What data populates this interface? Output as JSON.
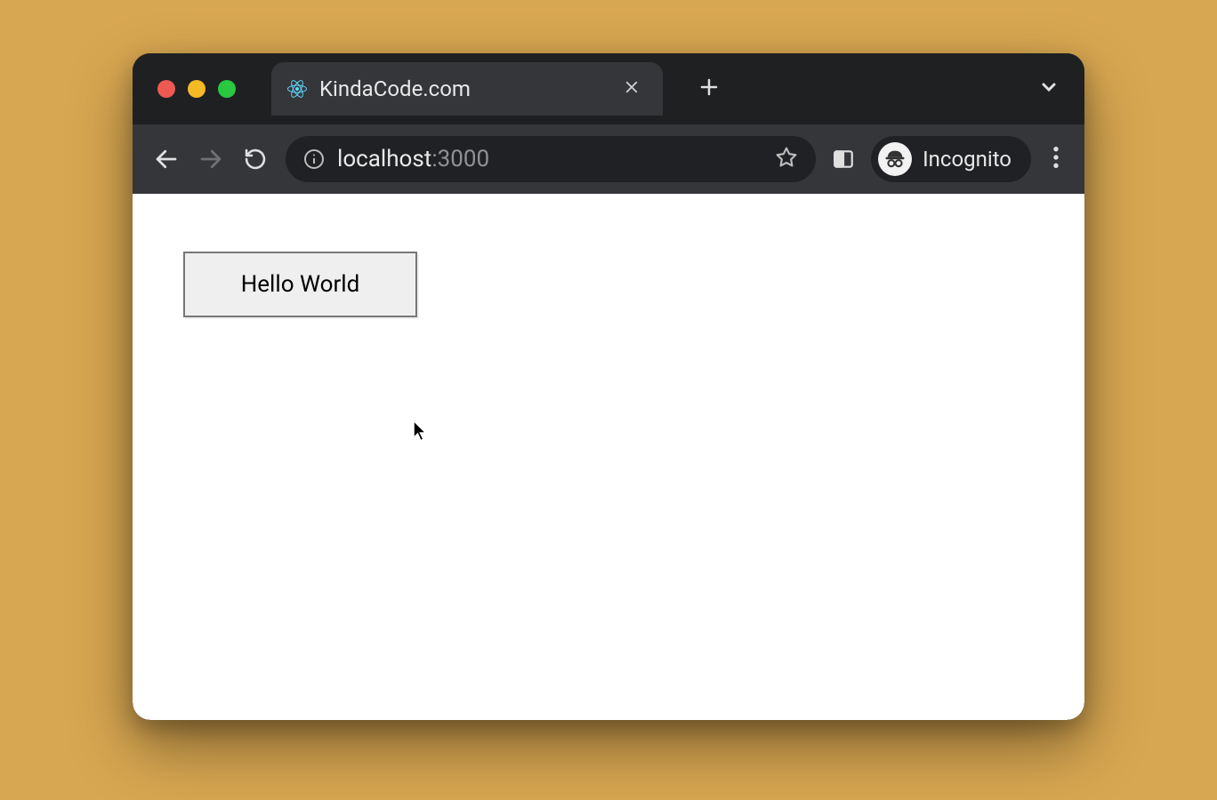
{
  "browser": {
    "tab": {
      "title": "KindaCode.com",
      "favicon": "react-icon"
    },
    "nav": {
      "back_enabled": true,
      "forward_enabled": false
    },
    "omnibox": {
      "host": "localhost",
      "port": ":3000"
    },
    "incognito_label": "Incognito"
  },
  "page": {
    "button_label": "Hello World"
  }
}
